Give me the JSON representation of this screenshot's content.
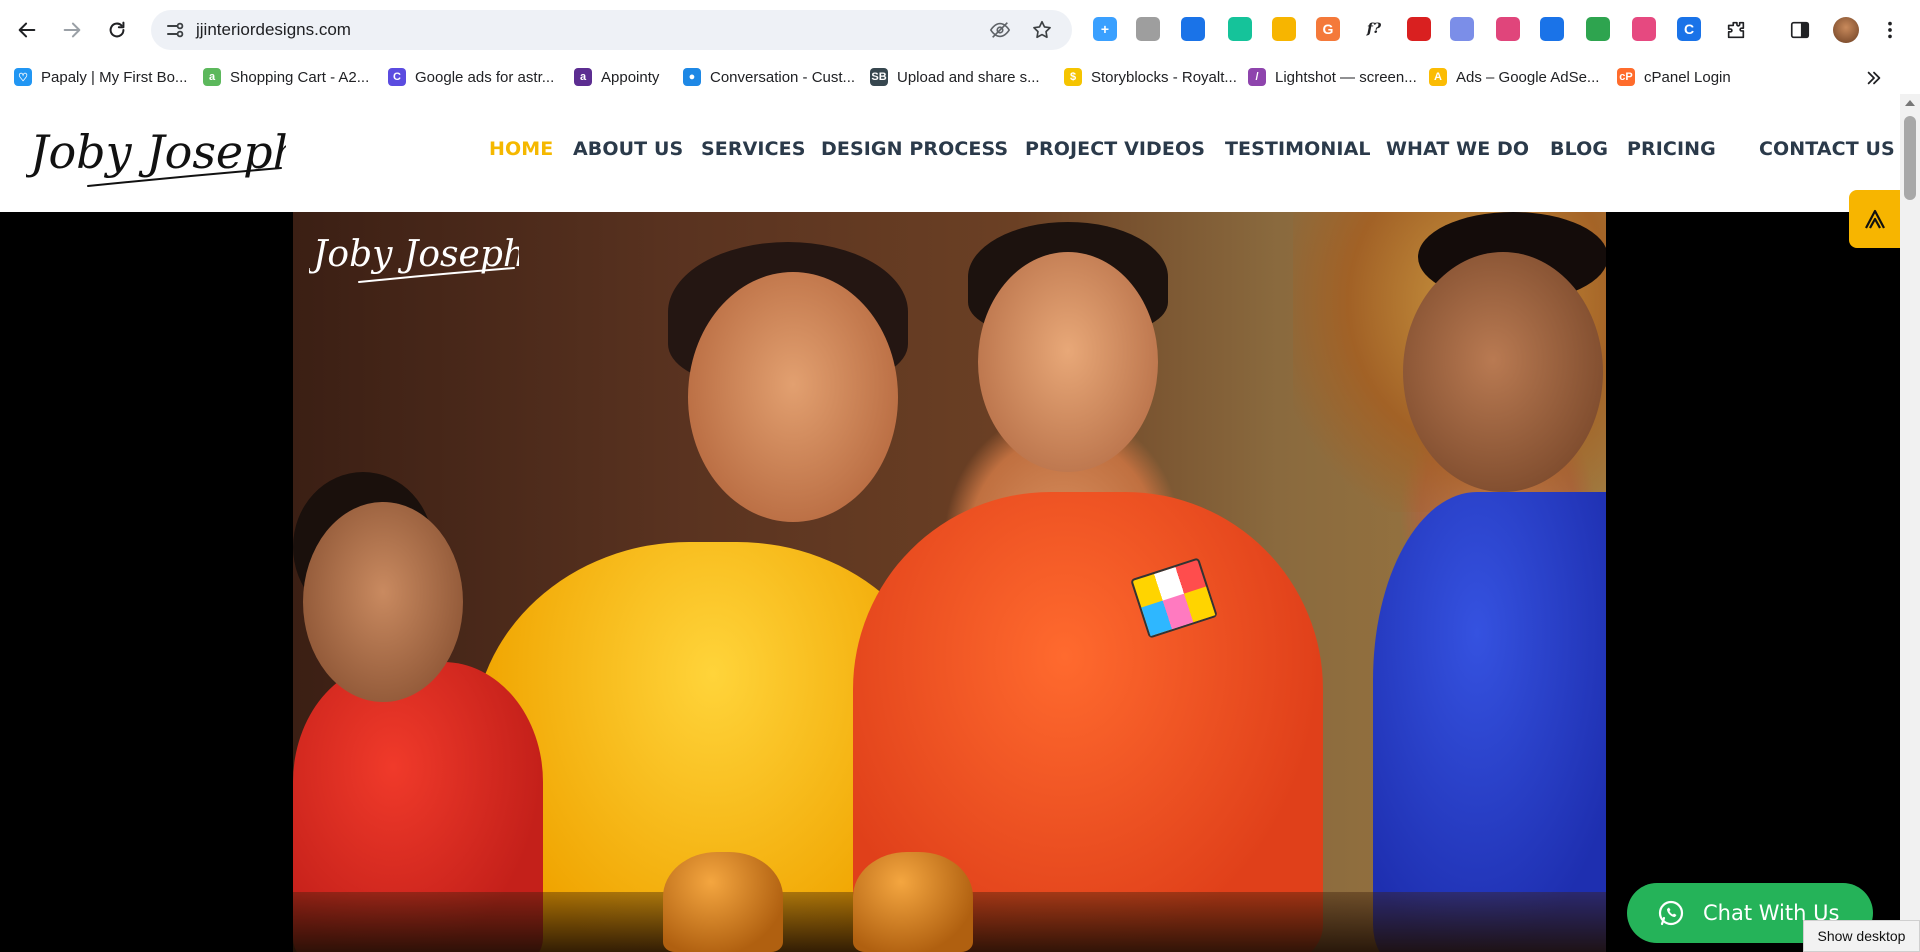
{
  "browser": {
    "url": "jjinteriordesigns.com",
    "colors": {
      "omnibox_bg": "#eef1f6"
    },
    "extensions": [
      {
        "name": "plus-extension",
        "glyph": "+",
        "color": "#3aa0ff"
      },
      {
        "name": "camera-extension",
        "glyph": "",
        "color": "#9e9e9e"
      },
      {
        "name": "play-extension",
        "glyph": "",
        "color": "#1a73e8"
      },
      {
        "name": "grammarly-extension",
        "glyph": "",
        "color": "#15c39a"
      },
      {
        "name": "vector-extension",
        "glyph": "",
        "color": "#f7b500"
      },
      {
        "name": "g-extension",
        "glyph": "G",
        "color": "#f4793a"
      },
      {
        "name": "formula-extension",
        "glyph": "f?",
        "color": "#ffffff"
      },
      {
        "name": "dots-extension",
        "glyph": "",
        "color": "#d92020"
      },
      {
        "name": "team-extension",
        "glyph": "",
        "color": "#7b8ee8"
      },
      {
        "name": "color-wheel-extension",
        "glyph": "",
        "color": "#e0457b"
      },
      {
        "name": "tag-extension",
        "glyph": "",
        "color": "#1a73e8"
      },
      {
        "name": "sheet-extension",
        "glyph": "",
        "color": "#2ea44f"
      },
      {
        "name": "pink-extension",
        "glyph": "",
        "color": "#e64980"
      },
      {
        "name": "c-extension",
        "glyph": "C",
        "color": "#1a73e8"
      }
    ]
  },
  "bookmarks": [
    {
      "label": "Papaly | My First Bo...",
      "icon": "heart-icon",
      "color": "#2196f3",
      "glyph": "♡"
    },
    {
      "label": "Shopping Cart - A2...",
      "icon": "a2-icon",
      "color": "#5cb85c",
      "glyph": "a"
    },
    {
      "label": "Google ads for astr...",
      "icon": "c-icon",
      "color": "#5b4ce0",
      "glyph": "C"
    },
    {
      "label": "Appointy",
      "icon": "appointy-icon",
      "color": "#5c2d91",
      "glyph": "a"
    },
    {
      "label": "Conversation - Cust...",
      "icon": "chat-bubble-icon",
      "color": "#1e88e5",
      "glyph": "●"
    },
    {
      "label": "Upload and share s...",
      "icon": "sb-icon",
      "color": "#37474f",
      "glyph": "SB"
    },
    {
      "label": "Storyblocks - Royalt...",
      "icon": "dollar-icon",
      "color": "#f5c400",
      "glyph": "$"
    },
    {
      "label": "Lightshot — screen...",
      "icon": "feather-icon",
      "color": "#8e44ad",
      "glyph": "/"
    },
    {
      "label": "Ads – Google AdSe...",
      "icon": "adsense-icon",
      "color": "#fbbc04",
      "glyph": "A"
    },
    {
      "label": "cPanel Login",
      "icon": "cpanel-icon",
      "color": "#ff6c2c",
      "glyph": "cP"
    }
  ],
  "site": {
    "nav": [
      {
        "label": "HOME",
        "active": true
      },
      {
        "label": "ABOUT US",
        "active": false
      },
      {
        "label": "SERVICES",
        "active": false
      },
      {
        "label": "DESIGN PROCESS",
        "active": false
      },
      {
        "label": "PROJECT VIDEOS",
        "active": false
      },
      {
        "label": "TESTIMONIAL",
        "active": false
      },
      {
        "label": "WHAT WE DO",
        "active": false
      },
      {
        "label": "BLOG",
        "active": false
      },
      {
        "label": "PRICING",
        "active": false
      },
      {
        "label": "CONTACT US",
        "active": false
      }
    ],
    "logo_text": "Joby Joseph",
    "chat_label": "Chat With Us",
    "colors": {
      "accent": "#f5b800",
      "nav_text": "#2b3a4a",
      "chat_green": "#25b359"
    }
  },
  "os": {
    "show_desktop_label": "Show desktop"
  }
}
